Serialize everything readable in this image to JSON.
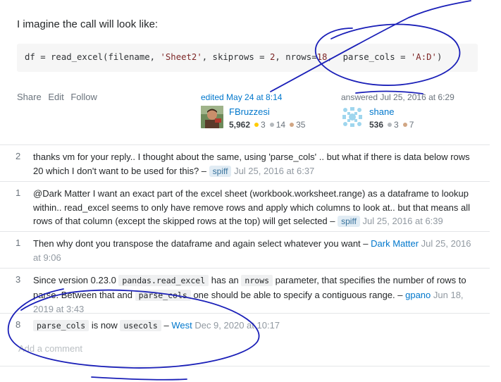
{
  "intro": "I imagine the call will look like:",
  "code": {
    "p1": "df = read_excel(filename, ",
    "s1": "'Sheet2'",
    "p2": ", skiprows = ",
    "n1": "2",
    "p3": ", nrows=",
    "n2": "18",
    "p4": ",  parse_cols = ",
    "s2": "'A:D'",
    "p5": ")"
  },
  "post_menu": {
    "share": "Share",
    "edit": "Edit",
    "follow": "Follow"
  },
  "editor": {
    "action": "edited May 24 at 8:14",
    "name": "FBruzzesi",
    "rep": "5,962",
    "gold": "3",
    "silver": "14",
    "bronze": "35"
  },
  "author": {
    "action": "answered Jul 25, 2016 at 6:29",
    "name": "shane",
    "rep": "536",
    "silver": "3",
    "bronze": "7"
  },
  "badge_colors": {
    "gold": "#ffcc01",
    "silver": "#b4b8bc",
    "bronze": "#d1a684"
  },
  "comments": [
    {
      "score": "2",
      "text": "thanks vm for your reply.. I thought about the same, using 'parse_cols' .. but what if there is data below rows 20 which I don't want to be used for this? –",
      "user": "spiff",
      "date": "Jul 25, 2016 at 6:37"
    },
    {
      "score": "1",
      "text": "@Dark Matter I want an exact part of the excel sheet (workbook.worksheet.range) as a dataframe to lookup within.. read_excel seems to only have remove rows and apply which columns to look at.. but that means all rows of that column (except the skipped rows at the top) will get selected –",
      "user": "spiff",
      "date": "Jul 25, 2016 at 6:39"
    },
    {
      "score": "1",
      "text": "Then why dont you transpose the dataframe and again select whatever you want –",
      "user": "Dark Matter",
      "date": "Jul 25, 2016 at 9:06"
    },
    {
      "score": "3",
      "t1": "Since version 0.23.0",
      "c1": "pandas.read_excel",
      "t2": "has an",
      "c2": "nrows",
      "t3": "parameter, that specifies the number of rows to parse. Between that and",
      "c3": "parse_cols",
      "t4": "one should be able to specify a contiguous range. –",
      "user": "gpano",
      "date": "Jun 18, 2019 at 3:43"
    },
    {
      "score": "8",
      "c1": "parse_cols",
      "t1": "is now",
      "c2": "usecols",
      "t2": "–",
      "user": "West",
      "date": "Dec 9, 2020 at 10:17"
    }
  ],
  "add_comment": "Add a comment",
  "ink_color": "#1a1fb8"
}
